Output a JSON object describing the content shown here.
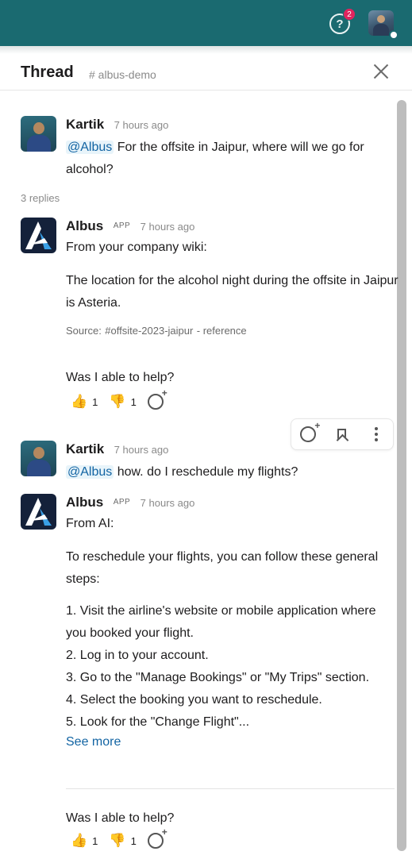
{
  "topbar": {
    "help_badge_count": "2",
    "help_icon": "?"
  },
  "thread": {
    "title": "Thread",
    "channel": "# albus-demo"
  },
  "replies_count": "3 replies",
  "messages": [
    {
      "author": "Kartik",
      "time": "7 hours ago",
      "mention": "@Albus",
      "text": " For the offsite in Jaipur, where will we go for alcohol?"
    },
    {
      "author": "Albus",
      "app_tag": "APP",
      "time": "7 hours ago",
      "line1": "From your company wiki:",
      "para": "The location for the alcohol night during the offsite in Jaipur is Asteria.",
      "source_label": "Source:",
      "source_channel": "#offsite-2023-jaipur",
      "source_ref": "- reference",
      "helpful_q": "Was I able to help?",
      "thumbs_up": "1",
      "thumbs_down": "1"
    },
    {
      "author": "Kartik",
      "time": "7 hours ago",
      "mention": "@Albus",
      "text": " how. do I reschedule my flights?"
    },
    {
      "author": "Albus",
      "app_tag": "APP",
      "time": "7 hours ago",
      "line1": "From AI:",
      "intro": "To reschedule your flights, you can follow these general steps:",
      "steps": [
        "1. Visit the airline's website or mobile application where you booked your flight.",
        "2. Log in to your account.",
        "3. Go to the \"Manage Bookings\" or \"My Trips\" section.",
        "4. Select the booking you want to reschedule.",
        "5. Look for the \"Change Flight\"..."
      ],
      "see_more": "See more",
      "helpful_q": "Was I able to help?",
      "thumbs_up": "1",
      "thumbs_down": "1"
    }
  ],
  "icons": {
    "thumbs_up": "👍",
    "thumbs_down": "👎",
    "add_reaction": "add-reaction-icon",
    "bookmark": "bookmark-icon",
    "more": "more-vertical-icon",
    "close": "close-icon"
  },
  "colors": {
    "topbar": "#1a6a70",
    "link": "#1264a3",
    "badge": "#e0245e"
  }
}
